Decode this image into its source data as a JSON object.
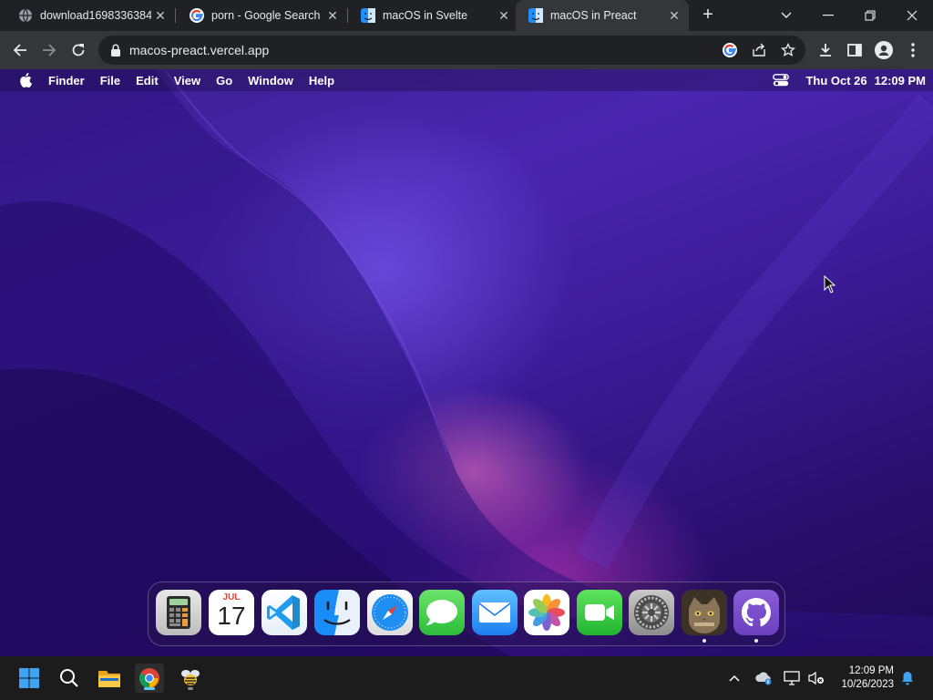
{
  "browser": {
    "tabs": [
      {
        "title": "download1698336384",
        "favicon": "globe-icon",
        "active": false
      },
      {
        "title": "porn - Google Search",
        "favicon": "google-icon",
        "active": false
      },
      {
        "title": "macOS in Svelte",
        "favicon": "finder-icon",
        "active": false
      },
      {
        "title": "macOS in Preact",
        "favicon": "finder-icon",
        "active": true
      }
    ],
    "close_glyph": "✕",
    "new_tab_glyph": "+",
    "url": "macos-preact.vercel.app"
  },
  "macos": {
    "menu": [
      "Finder",
      "File",
      "Edit",
      "View",
      "Go",
      "Window",
      "Help"
    ],
    "date": "Thu Oct 26",
    "time": "12:09 PM",
    "dock": [
      {
        "name": "Calculator",
        "icon": "calculator-icon",
        "running": false
      },
      {
        "name": "Calendar",
        "icon": "calendar-icon",
        "month": "JUL",
        "day": "17",
        "running": false
      },
      {
        "name": "VS Code",
        "icon": "vscode-icon",
        "running": false
      },
      {
        "name": "Finder",
        "icon": "finder-icon",
        "running": false
      },
      {
        "name": "Safari",
        "icon": "safari-icon",
        "running": false
      },
      {
        "name": "Messages",
        "icon": "messages-icon",
        "running": false
      },
      {
        "name": "Mail",
        "icon": "mail-icon",
        "running": false
      },
      {
        "name": "Photos",
        "icon": "photos-icon",
        "running": false
      },
      {
        "name": "FaceTime",
        "icon": "facetime-icon",
        "running": false
      },
      {
        "name": "System Preferences",
        "icon": "settings-icon",
        "running": false
      },
      {
        "name": "Purus Twitter",
        "icon": "cat-avatar-icon",
        "running": true
      },
      {
        "name": "GitHub",
        "icon": "github-icon",
        "running": true
      }
    ]
  },
  "taskbar": {
    "time": "12:09 PM",
    "date": "10/26/2023"
  },
  "colors": {
    "chrome_bg": "#202124",
    "chrome_toolbar": "#35363a",
    "taskbar_bg": "#1c1c1c",
    "win_accent": "#60cdff"
  }
}
